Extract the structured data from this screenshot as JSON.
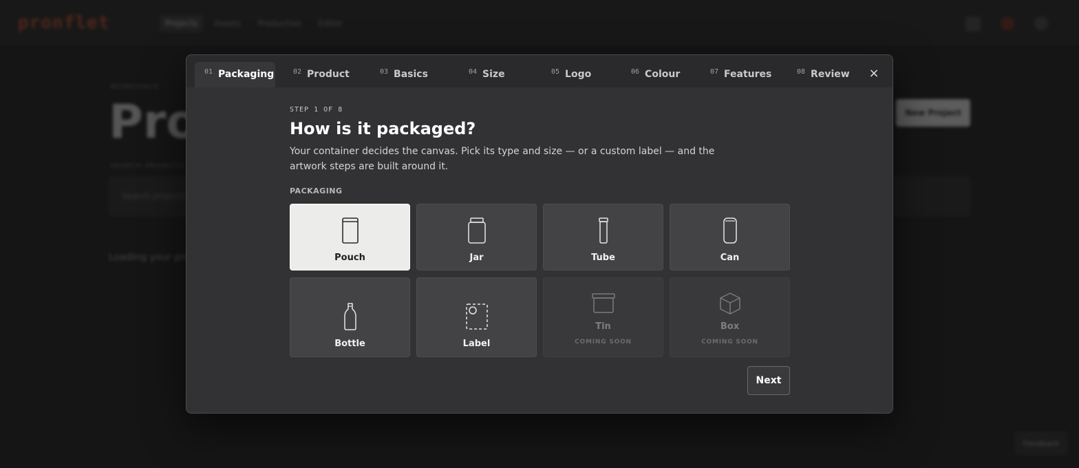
{
  "background": {
    "brand": "pronflet",
    "nav": [
      "Projects",
      "Assets",
      "Production",
      "Editor"
    ],
    "eyebrow": "WORKSPACE",
    "title": "Proj",
    "new_project": "New Project",
    "search_label": "SEARCH PROJECTS",
    "search_placeholder": "Search projects...",
    "loading": "Loading your pro",
    "feedback": "Feedback"
  },
  "wizard": {
    "tabs": [
      {
        "num": "01",
        "label": "Packaging"
      },
      {
        "num": "02",
        "label": "Product"
      },
      {
        "num": "03",
        "label": "Basics"
      },
      {
        "num": "04",
        "label": "Size"
      },
      {
        "num": "05",
        "label": "Logo"
      },
      {
        "num": "06",
        "label": "Colour"
      },
      {
        "num": "07",
        "label": "Features"
      },
      {
        "num": "08",
        "label": "Review"
      }
    ],
    "active_tab": "Packaging",
    "close": "×",
    "step": "STEP 1 OF 8",
    "heading": "How is it packaged?",
    "description": "Your container decides the canvas. Pick its type and size — or a custom label — and the artwork steps are built around it.",
    "section_label": "PACKAGING",
    "options": [
      {
        "label": "Pouch",
        "icon": "pouch-icon",
        "selected": true
      },
      {
        "label": "Jar",
        "icon": "jar-icon"
      },
      {
        "label": "Tube",
        "icon": "tube-icon"
      },
      {
        "label": "Can",
        "icon": "can-icon"
      },
      {
        "label": "Bottle",
        "icon": "bottle-icon"
      },
      {
        "label": "Label",
        "icon": "label-icon"
      },
      {
        "label": "Tin",
        "icon": "tin-icon",
        "sub": "COMING SOON",
        "disabled": true
      },
      {
        "label": "Box",
        "icon": "box-icon",
        "sub": "COMING SOON",
        "disabled": true
      }
    ],
    "next": "Next"
  },
  "colors": {
    "modal_bg": "#323234",
    "selected_card": "#ececea",
    "card_bg": "#434346",
    "brand": "#b34a2c"
  }
}
